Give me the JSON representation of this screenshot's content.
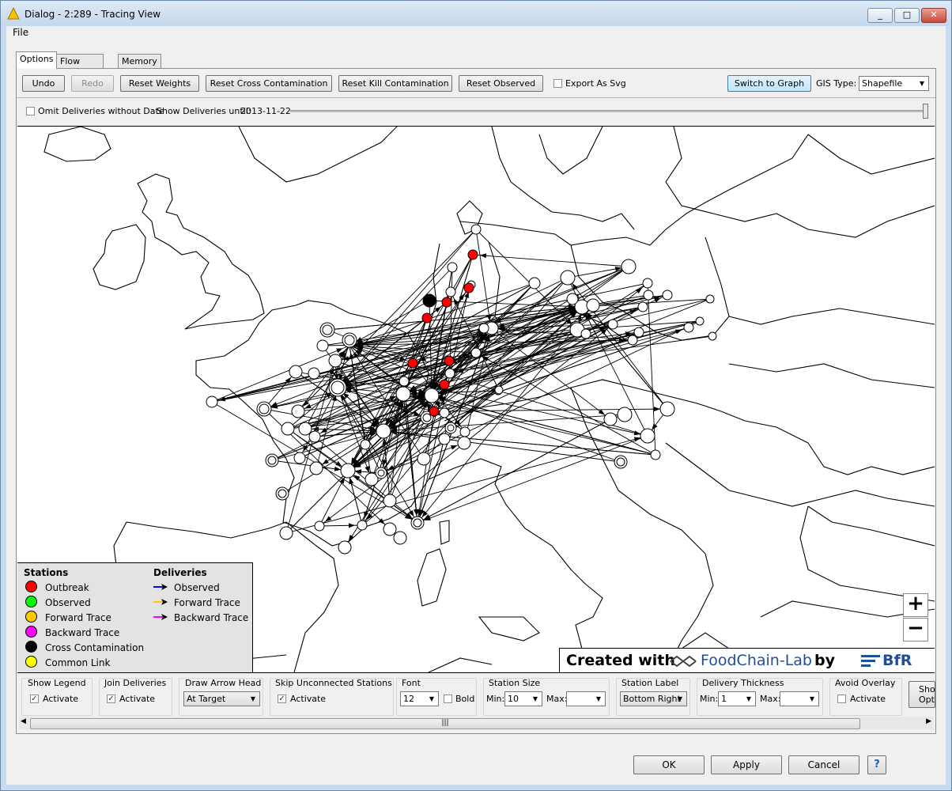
{
  "window": {
    "title": "Dialog - 2:289 - Tracing View",
    "minimize": "_",
    "maximize": "□",
    "close": "✕"
  },
  "menu": {
    "file": "File"
  },
  "tabs": [
    "Options",
    "Flow Variables",
    "Memory Policy"
  ],
  "toolbar": {
    "undo": "Undo",
    "redo": "Redo",
    "reset_weights": "Reset Weights",
    "reset_cross": "Reset Cross Contamination",
    "reset_kill": "Reset Kill Contamination",
    "reset_observed": "Reset Observed",
    "export_svg": "Export As Svg",
    "switch_graph": "Switch to Graph",
    "gis_type_label": "GIS Type:",
    "gis_type_value": "Shapefile"
  },
  "filter": {
    "omit_label": "Omit Deliveries without Date",
    "show_until_label": "Show Deliveries until:",
    "show_until_value": "2013-11-22"
  },
  "legend": {
    "stations_title": "Stations",
    "deliveries_title": "Deliveries",
    "stations": [
      {
        "label": "Outbreak",
        "color": "#ff0000"
      },
      {
        "label": "Observed",
        "color": "#00ff00"
      },
      {
        "label": "Forward Trace",
        "color": "#ffc800"
      },
      {
        "label": "Backward Trace",
        "color": "#ff00ff"
      },
      {
        "label": "Cross Contamination",
        "color": "#000000"
      },
      {
        "label": "Common Link",
        "color": "#ffff00"
      }
    ],
    "deliveries": [
      {
        "label": "Observed",
        "color": "#0000ff"
      },
      {
        "label": "Forward Trace",
        "color": "#ffc800"
      },
      {
        "label": "Backward Trace",
        "color": "#ff00ff"
      }
    ]
  },
  "map": {
    "zoom_in": "+",
    "zoom_out": "−",
    "credit_created": "Created with",
    "credit_app": "FoodChain-Lab",
    "credit_by": "by",
    "credit_org": "BfR"
  },
  "options": {
    "show_legend": {
      "title": "Show Legend",
      "label": "Activate",
      "checked": "✓"
    },
    "join_deliveries": {
      "title": "Join Deliveries",
      "label": "Activate",
      "checked": "✓"
    },
    "draw_arrow_head": {
      "title": "Draw Arrow Head",
      "value": "At Target"
    },
    "skip_unconnected": {
      "title": "Skip Unconnected Stations",
      "label": "Activate",
      "checked": "✓"
    },
    "font": {
      "title": "Font",
      "size": "12",
      "bold_label": "Bold"
    },
    "station_size": {
      "title": "Station Size",
      "min_label": "Min:",
      "min_value": "10",
      "max_label": "Max:",
      "max_value": ""
    },
    "station_label": {
      "title": "Station Label",
      "value": "Bottom Right"
    },
    "delivery_thickness": {
      "title": "Delivery Thickness",
      "min_label": "Min:",
      "min_value": "1",
      "max_label": "Max:",
      "max_value": ""
    },
    "avoid_overlay": {
      "title": "Avoid Overlay",
      "label": "Activate"
    },
    "show_options": {
      "line1": "Sho",
      "line2": "Opt"
    }
  },
  "scroll": {
    "grip": "|||"
  },
  "footer": {
    "ok": "OK",
    "apply": "Apply",
    "cancel": "Cancel",
    "help": "?"
  }
}
